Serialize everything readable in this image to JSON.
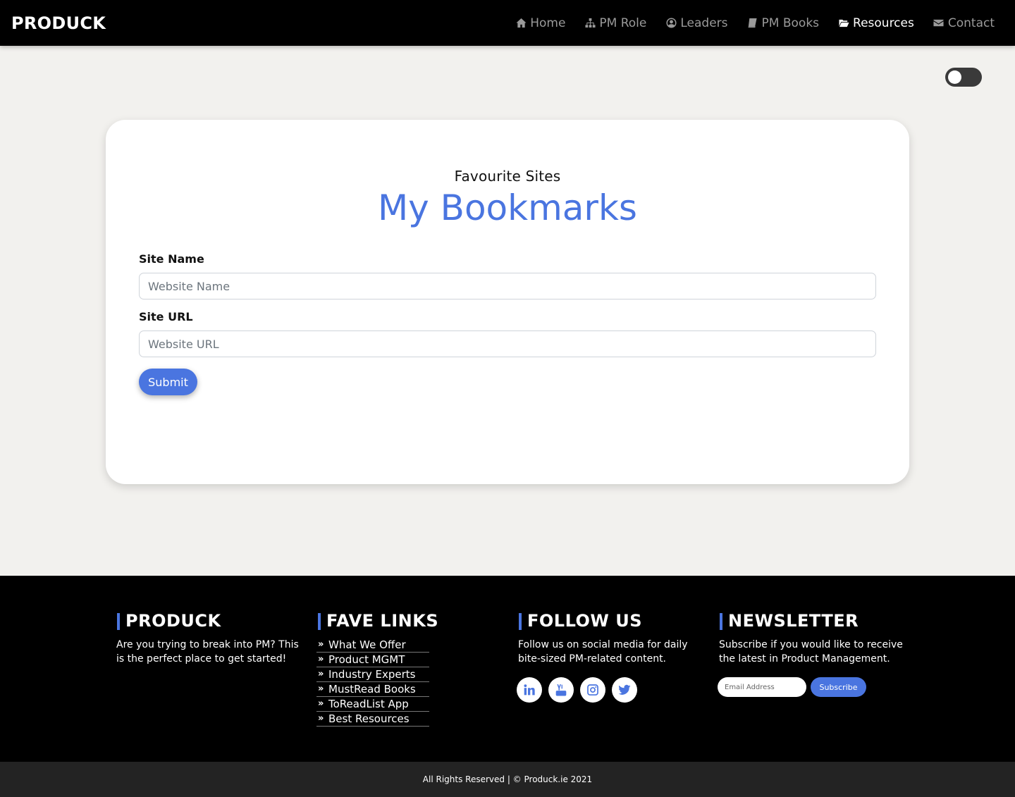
{
  "brand": "PRODUCK",
  "nav": [
    {
      "label": "Home",
      "icon": "home-icon",
      "active": false
    },
    {
      "label": "PM Role",
      "icon": "sitemap-icon",
      "active": false
    },
    {
      "label": "Leaders",
      "icon": "user-circle-icon",
      "active": false
    },
    {
      "label": "PM Books",
      "icon": "book-icon",
      "active": false
    },
    {
      "label": "Resources",
      "icon": "folder-open-icon",
      "active": true
    },
    {
      "label": "Contact",
      "icon": "envelope-icon",
      "active": false
    }
  ],
  "theme_toggle": {
    "state": "off"
  },
  "card": {
    "subtitle": "Favourite Sites",
    "title": "My Bookmarks",
    "site_name_label": "Site Name",
    "site_name_placeholder": "Website Name",
    "site_url_label": "Site URL",
    "site_url_placeholder": "Website URL",
    "submit_label": "Submit"
  },
  "footer": {
    "about": {
      "heading": "PRODUCK",
      "text": "Are you trying to break into PM? This is the perfect place to get started!"
    },
    "links": {
      "heading": "FAVE LINKS",
      "items": [
        "What We Offer",
        "Product MGMT",
        "Industry Experts",
        "MustRead Books",
        "ToReadList App",
        "Best Resources"
      ]
    },
    "follow": {
      "heading": "FOLLOW US",
      "text": "Follow us on social media for daily bite-sized PM-related content.",
      "icons": [
        "linkedin-icon",
        "youtube-icon",
        "instagram-icon",
        "twitter-icon"
      ]
    },
    "newsletter": {
      "heading": "NEWSLETTER",
      "text": "Subscribe if you would like to receive the latest in Product Management.",
      "email_placeholder": "Email Address",
      "subscribe_label": "Subscribe"
    },
    "copyright": "All Rights Reserved | © Produck.ie 2021"
  },
  "colors": {
    "accent": "#4a75e0",
    "navbar": "#000000",
    "page_bg": "#f2f1ee",
    "footer_bottom": "#232323"
  }
}
